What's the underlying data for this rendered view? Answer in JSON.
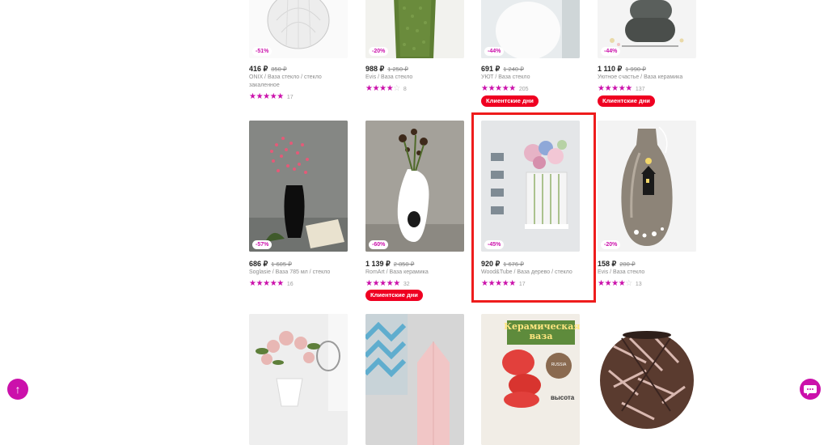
{
  "products": [
    {
      "price": "416 ₽",
      "old_price": "850 ₽",
      "discount": "-51%",
      "desc": "ONIX / Ваза стекло / стекло закаленное",
      "stars": 5,
      "count": "17",
      "promo": ""
    },
    {
      "price": "988 ₽",
      "old_price": "1 250 ₽",
      "discount": "-20%",
      "desc": "Evis / Ваза стекло",
      "stars": 4,
      "count": "8",
      "promo": ""
    },
    {
      "price": "691 ₽",
      "old_price": "1 240 ₽",
      "discount": "-44%",
      "desc": "УЮТ / Ваза стекло",
      "stars": 5,
      "count": "205",
      "promo": "Клиентские дни"
    },
    {
      "price": "1 110 ₽",
      "old_price": "1 990 ₽",
      "discount": "-44%",
      "desc": "Уютное счастье / Ваза керамика",
      "stars": 5,
      "count": "137",
      "promo": "Клиентские дни"
    },
    {
      "price": "686 ₽",
      "old_price": "1 605 ₽",
      "discount": "-57%",
      "desc": "Soglasie / Ваза 785 мл / стекло",
      "stars": 5,
      "count": "16",
      "promo": ""
    },
    {
      "price": "1 139 ₽",
      "old_price": "2 850 ₽",
      "discount": "-60%",
      "desc": "RomArt / Ваза керамика",
      "stars": 5,
      "count": "32",
      "promo": "Клиентские дни"
    },
    {
      "price": "920 ₽",
      "old_price": "1 676 ₽",
      "discount": "-45%",
      "desc": "Wood&Tube / Ваза дерево / стекло",
      "stars": 5,
      "count": "17",
      "promo": ""
    },
    {
      "price": "158 ₽",
      "old_price": "200 ₽",
      "discount": "-20%",
      "desc": "Evis / Ваза стекло",
      "stars": 4,
      "count": "13",
      "promo": ""
    }
  ],
  "bottom_image_texts": {
    "title": "Керамическая ваза",
    "badge": "RUSSIA",
    "footer": "высота"
  },
  "scroll_up_icon": "arrow-up-icon",
  "chat_icon": "chat-bubble-icon",
  "colors": {
    "accent": "#cb11ab",
    "promo": "#ef0021",
    "highlight": "#ee1c1c"
  }
}
